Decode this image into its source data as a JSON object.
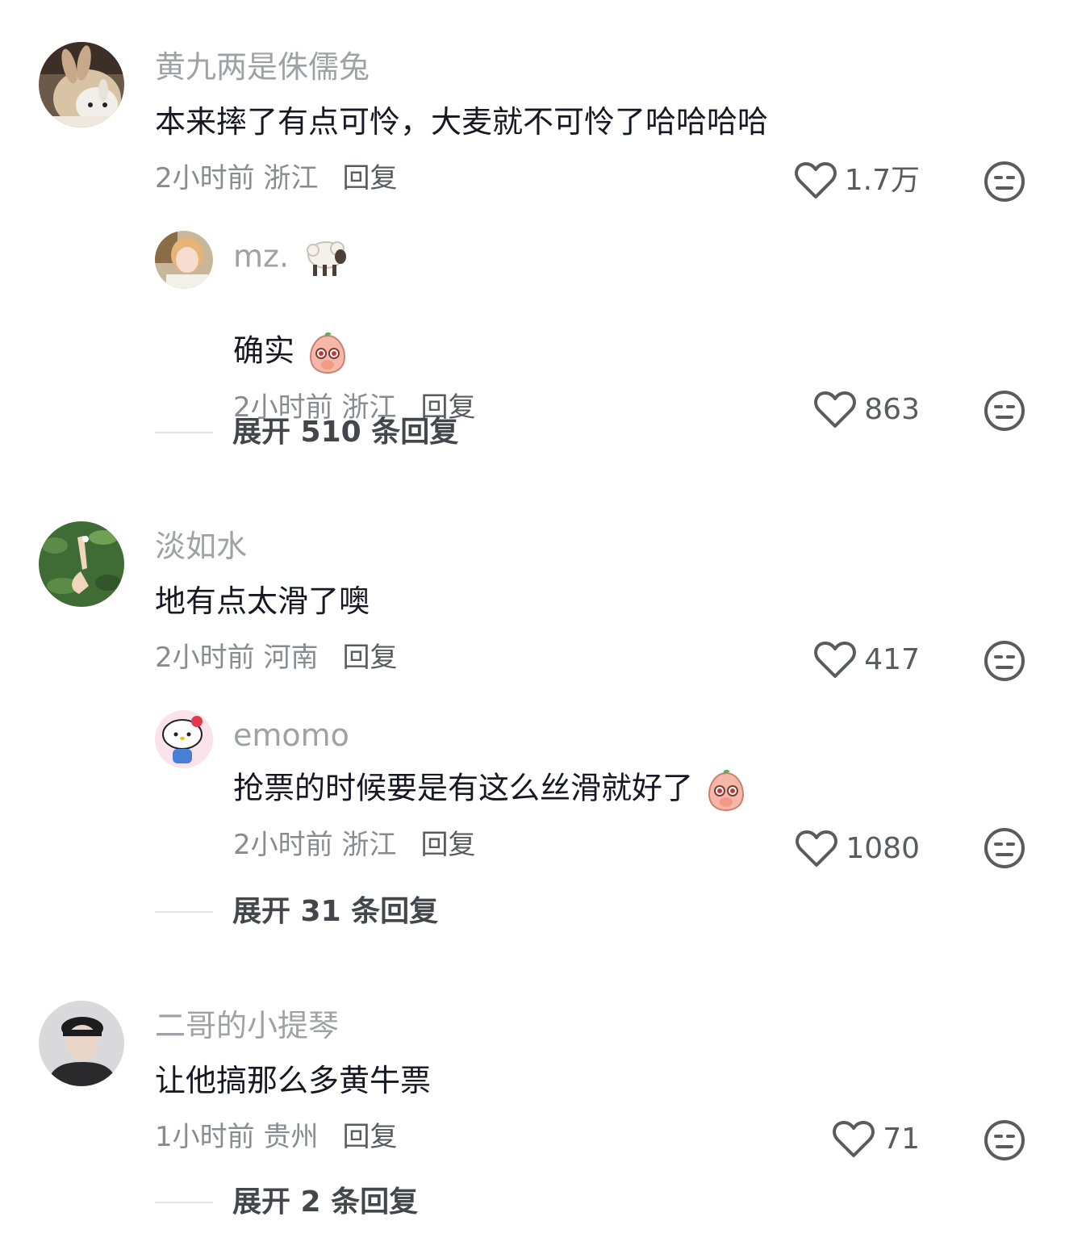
{
  "comments": [
    {
      "username": "黄九两是侏儒兔",
      "text": "本来摔了有点可怜，大麦就不可怜了哈哈哈哈",
      "time_location": "2小时前 浙江",
      "reply_label": "回复",
      "likes": "1.7万",
      "sub_reply": {
        "username": "mz.",
        "text": "确实",
        "time_location": "2小时前 浙江",
        "reply_label": "回复",
        "likes": "863"
      },
      "expand_label": "展开 510 条回复"
    },
    {
      "username": "淡如水",
      "text": "地有点太滑了噢",
      "time_location": "2小时前 河南",
      "reply_label": "回复",
      "likes": "417",
      "sub_reply": {
        "username": "emomo",
        "text": "抢票的时候要是有这么丝滑就好了",
        "time_location": "2小时前 浙江",
        "reply_label": "回复",
        "likes": "1080"
      },
      "expand_label": "展开 31 条回复"
    },
    {
      "username": "二哥的小提琴",
      "text": "让他搞那么多黄牛票",
      "time_location": "1小时前 贵州",
      "reply_label": "回复",
      "likes": "71",
      "expand_label": "展开 2 条回复"
    }
  ],
  "icons": {
    "like": "heart-outline-icon",
    "dislike": "meh-face-icon",
    "sheep": "sheep-emoji",
    "peach": "shy-peach-emoji"
  }
}
